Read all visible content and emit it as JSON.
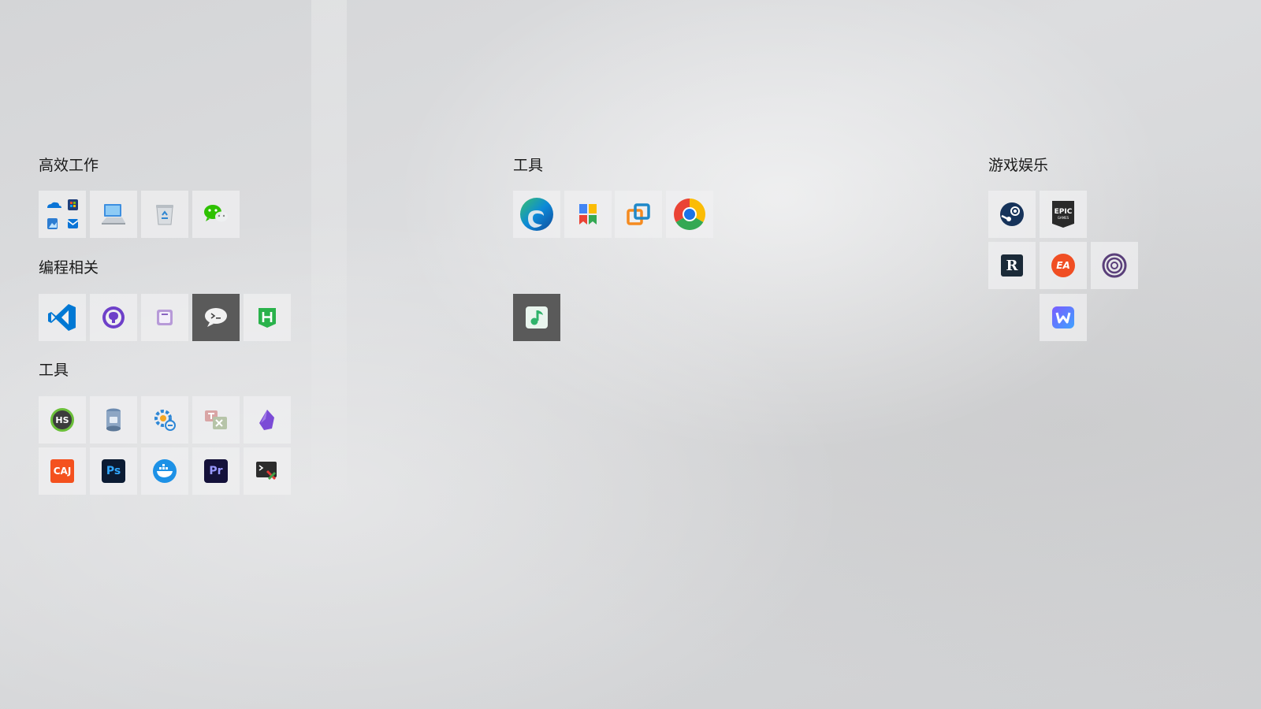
{
  "groups": {
    "productivity": {
      "title": "高效工作"
    },
    "programming": {
      "title": "编程相关"
    },
    "tools_left": {
      "title": "工具"
    },
    "tools_center": {
      "title": "工具"
    },
    "gaming": {
      "title": "游戏娱乐"
    }
  },
  "tile_logos": {
    "epic": "EPIC",
    "epic_sub": "GAMES",
    "rockstar": "R",
    "ea": "EA",
    "hs": "HS",
    "caj": "CAJ",
    "ps": "Ps",
    "pr": "Pr"
  },
  "colors": {
    "vscode": "#0078d4",
    "github_desktop": "#6e40c9",
    "hbuilder": "#2ab24b",
    "edge": "#0c8ad8",
    "chrome_red": "#db4437",
    "epic": "#2a2a2a",
    "ea": "#f04e23",
    "caj": "#f4511e",
    "photoshop": "#0b1b33",
    "premiere": "#14113a",
    "docker": "#1d91e6"
  }
}
